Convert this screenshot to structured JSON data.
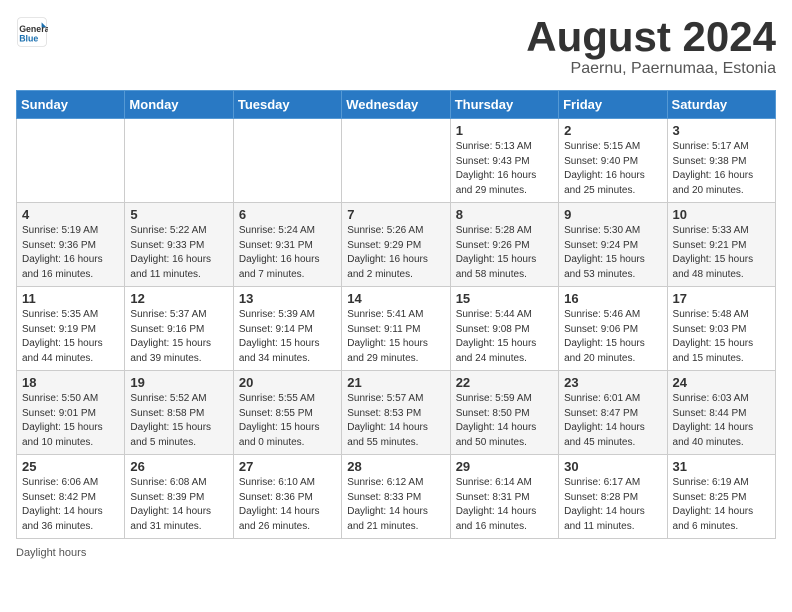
{
  "header": {
    "logo_general": "General",
    "logo_blue": "Blue",
    "month_title": "August 2024",
    "location": "Paernu, Paernumaa, Estonia"
  },
  "weekdays": [
    "Sunday",
    "Monday",
    "Tuesday",
    "Wednesday",
    "Thursday",
    "Friday",
    "Saturday"
  ],
  "footer": {
    "daylight_label": "Daylight hours"
  },
  "weeks": [
    [
      {
        "day": "",
        "info": ""
      },
      {
        "day": "",
        "info": ""
      },
      {
        "day": "",
        "info": ""
      },
      {
        "day": "",
        "info": ""
      },
      {
        "day": "1",
        "info": "Sunrise: 5:13 AM\nSunset: 9:43 PM\nDaylight: 16 hours\nand 29 minutes."
      },
      {
        "day": "2",
        "info": "Sunrise: 5:15 AM\nSunset: 9:40 PM\nDaylight: 16 hours\nand 25 minutes."
      },
      {
        "day": "3",
        "info": "Sunrise: 5:17 AM\nSunset: 9:38 PM\nDaylight: 16 hours\nand 20 minutes."
      }
    ],
    [
      {
        "day": "4",
        "info": "Sunrise: 5:19 AM\nSunset: 9:36 PM\nDaylight: 16 hours\nand 16 minutes."
      },
      {
        "day": "5",
        "info": "Sunrise: 5:22 AM\nSunset: 9:33 PM\nDaylight: 16 hours\nand 11 minutes."
      },
      {
        "day": "6",
        "info": "Sunrise: 5:24 AM\nSunset: 9:31 PM\nDaylight: 16 hours\nand 7 minutes."
      },
      {
        "day": "7",
        "info": "Sunrise: 5:26 AM\nSunset: 9:29 PM\nDaylight: 16 hours\nand 2 minutes."
      },
      {
        "day": "8",
        "info": "Sunrise: 5:28 AM\nSunset: 9:26 PM\nDaylight: 15 hours\nand 58 minutes."
      },
      {
        "day": "9",
        "info": "Sunrise: 5:30 AM\nSunset: 9:24 PM\nDaylight: 15 hours\nand 53 minutes."
      },
      {
        "day": "10",
        "info": "Sunrise: 5:33 AM\nSunset: 9:21 PM\nDaylight: 15 hours\nand 48 minutes."
      }
    ],
    [
      {
        "day": "11",
        "info": "Sunrise: 5:35 AM\nSunset: 9:19 PM\nDaylight: 15 hours\nand 44 minutes."
      },
      {
        "day": "12",
        "info": "Sunrise: 5:37 AM\nSunset: 9:16 PM\nDaylight: 15 hours\nand 39 minutes."
      },
      {
        "day": "13",
        "info": "Sunrise: 5:39 AM\nSunset: 9:14 PM\nDaylight: 15 hours\nand 34 minutes."
      },
      {
        "day": "14",
        "info": "Sunrise: 5:41 AM\nSunset: 9:11 PM\nDaylight: 15 hours\nand 29 minutes."
      },
      {
        "day": "15",
        "info": "Sunrise: 5:44 AM\nSunset: 9:08 PM\nDaylight: 15 hours\nand 24 minutes."
      },
      {
        "day": "16",
        "info": "Sunrise: 5:46 AM\nSunset: 9:06 PM\nDaylight: 15 hours\nand 20 minutes."
      },
      {
        "day": "17",
        "info": "Sunrise: 5:48 AM\nSunset: 9:03 PM\nDaylight: 15 hours\nand 15 minutes."
      }
    ],
    [
      {
        "day": "18",
        "info": "Sunrise: 5:50 AM\nSunset: 9:01 PM\nDaylight: 15 hours\nand 10 minutes."
      },
      {
        "day": "19",
        "info": "Sunrise: 5:52 AM\nSunset: 8:58 PM\nDaylight: 15 hours\nand 5 minutes."
      },
      {
        "day": "20",
        "info": "Sunrise: 5:55 AM\nSunset: 8:55 PM\nDaylight: 15 hours\nand 0 minutes."
      },
      {
        "day": "21",
        "info": "Sunrise: 5:57 AM\nSunset: 8:53 PM\nDaylight: 14 hours\nand 55 minutes."
      },
      {
        "day": "22",
        "info": "Sunrise: 5:59 AM\nSunset: 8:50 PM\nDaylight: 14 hours\nand 50 minutes."
      },
      {
        "day": "23",
        "info": "Sunrise: 6:01 AM\nSunset: 8:47 PM\nDaylight: 14 hours\nand 45 minutes."
      },
      {
        "day": "24",
        "info": "Sunrise: 6:03 AM\nSunset: 8:44 PM\nDaylight: 14 hours\nand 40 minutes."
      }
    ],
    [
      {
        "day": "25",
        "info": "Sunrise: 6:06 AM\nSunset: 8:42 PM\nDaylight: 14 hours\nand 36 minutes."
      },
      {
        "day": "26",
        "info": "Sunrise: 6:08 AM\nSunset: 8:39 PM\nDaylight: 14 hours\nand 31 minutes."
      },
      {
        "day": "27",
        "info": "Sunrise: 6:10 AM\nSunset: 8:36 PM\nDaylight: 14 hours\nand 26 minutes."
      },
      {
        "day": "28",
        "info": "Sunrise: 6:12 AM\nSunset: 8:33 PM\nDaylight: 14 hours\nand 21 minutes."
      },
      {
        "day": "29",
        "info": "Sunrise: 6:14 AM\nSunset: 8:31 PM\nDaylight: 14 hours\nand 16 minutes."
      },
      {
        "day": "30",
        "info": "Sunrise: 6:17 AM\nSunset: 8:28 PM\nDaylight: 14 hours\nand 11 minutes."
      },
      {
        "day": "31",
        "info": "Sunrise: 6:19 AM\nSunset: 8:25 PM\nDaylight: 14 hours\nand 6 minutes."
      }
    ]
  ]
}
